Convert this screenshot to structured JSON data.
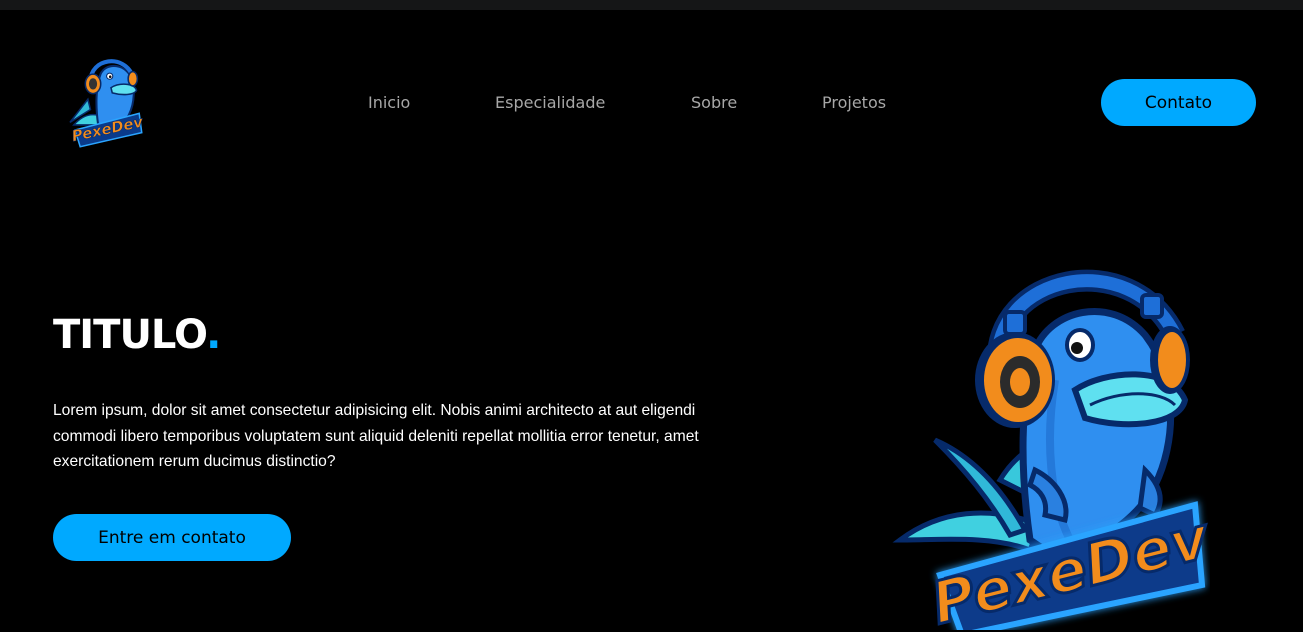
{
  "header": {
    "logo_text": "PexeDev",
    "nav": [
      {
        "label": "Inicio"
      },
      {
        "label": "Especialidade"
      },
      {
        "label": "Sobre"
      },
      {
        "label": "Projetos"
      }
    ],
    "cta_label": "Contato"
  },
  "hero": {
    "title": "TITULO",
    "title_dot": ".",
    "paragraph": "Lorem ipsum, dolor sit amet consectetur adipisicing elit. Nobis animi architecto at aut eligendi commodi libero temporibus voluptatem sunt aliquid deleniti repellat mollitia error tenetur, amet exercitationem rerum ducimus distinctio?",
    "cta_label": "Entre em contato",
    "mascot_text": "PexeDev"
  },
  "colors": {
    "background": "#000000",
    "accent": "#00a9ff",
    "nav_text": "#a7a7a7",
    "text": "#ffffff",
    "logo_orange": "#f28c1c"
  },
  "icons": {
    "logo": "fish-mascot-with-headphones",
    "hero_image": "fish-mascot-with-headphones"
  }
}
